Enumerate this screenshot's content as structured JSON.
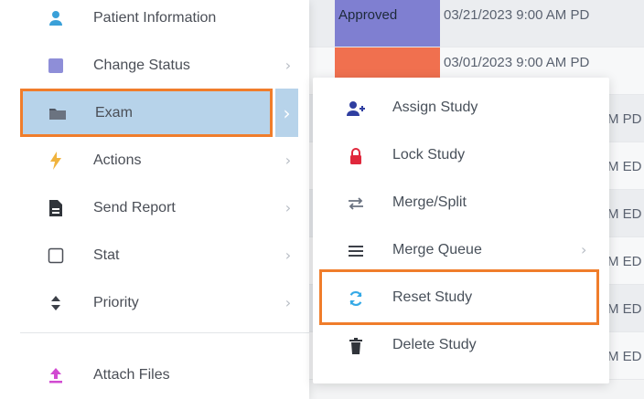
{
  "background_table": {
    "rows": [
      {
        "status": "Approved",
        "date": "03/21/2023 9:00 AM PD"
      },
      {
        "status": "",
        "date": "03/01/2023 9:00 AM PD"
      },
      {
        "status": "",
        "date": "M PD"
      },
      {
        "status": "",
        "date": "M ED"
      },
      {
        "status": "",
        "date": "M ED"
      },
      {
        "status": "",
        "date": "M ED"
      },
      {
        "status": "",
        "date": "M ED"
      },
      {
        "status": "",
        "date": "M ED"
      }
    ]
  },
  "menu": {
    "items": [
      {
        "label": "Patient Information",
        "icon": "user-icon"
      },
      {
        "label": "Change Status",
        "icon": "square-icon"
      },
      {
        "label": "Exam",
        "icon": "folder-icon"
      },
      {
        "label": "Actions",
        "icon": "bolt-icon"
      },
      {
        "label": "Send Report",
        "icon": "document-icon"
      },
      {
        "label": "Stat",
        "icon": "checkbox-icon"
      },
      {
        "label": "Priority",
        "icon": "sort-icon"
      },
      {
        "label": "Attach Files",
        "icon": "upload-icon"
      }
    ]
  },
  "submenu": {
    "items": [
      {
        "label": "Assign Study",
        "icon": "assign-user-icon"
      },
      {
        "label": "Lock Study",
        "icon": "lock-icon"
      },
      {
        "label": "Merge/Split",
        "icon": "merge-split-icon"
      },
      {
        "label": "Merge Queue",
        "icon": "list-icon"
      },
      {
        "label": "Reset Study",
        "icon": "refresh-icon"
      },
      {
        "label": "Delete Study",
        "icon": "trash-icon"
      }
    ]
  },
  "colors": {
    "highlight": "#f07d2b",
    "selected_bg": "#b7d3ea",
    "approved": "#7f7fd1",
    "pending": "#f0704f",
    "teal": "#7fc7b7",
    "user_icon": "#3aa0d8",
    "square_icon": "#8e8ed8",
    "bolt_icon": "#f0b33d",
    "lock_icon": "#e0273c",
    "assign_icon": "#2f3ea0",
    "attach_icon": "#d14bd1",
    "refresh_icon": "#35a9e6"
  }
}
